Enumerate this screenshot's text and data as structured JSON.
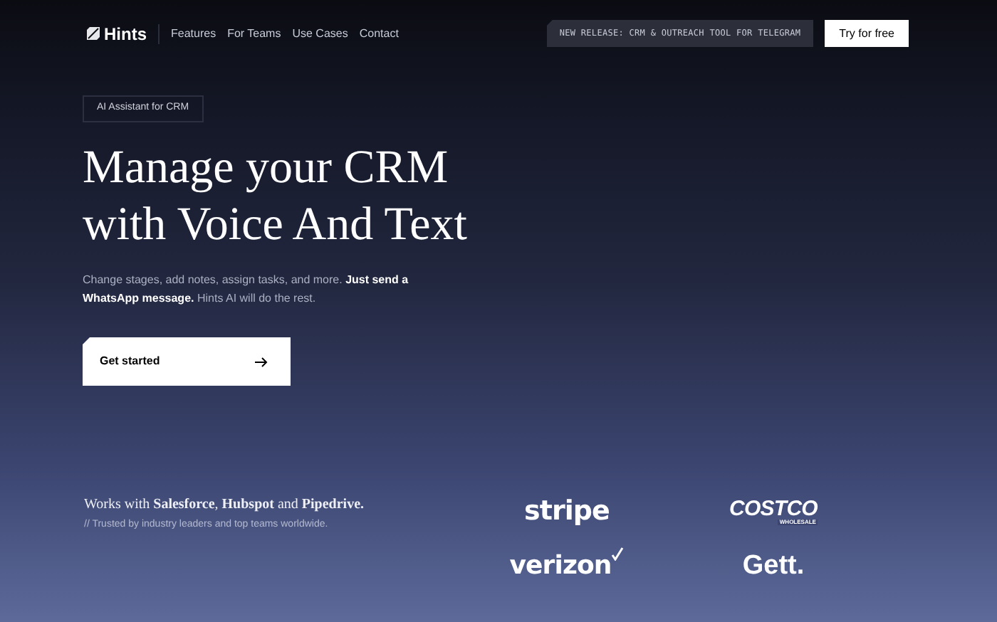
{
  "nav": {
    "brand": "Hints",
    "links": [
      "Features",
      "For Teams",
      "Use Cases",
      "Contact"
    ],
    "announcement": "NEW RELEASE: CRM & OUTREACH TOOL FOR TELEGRAM",
    "cta": "Try for free"
  },
  "hero": {
    "badge": "AI Assistant for CRM",
    "headline_lines": [
      "Manage your CRM",
      "with Voice And Text"
    ],
    "subtitle": "Change stages, add notes, assign tasks, and more. **Just send a WhatsApp message.** Hints AI will do the rest.",
    "button": "Get started"
  },
  "partners": {
    "heading": "Works with **Salesforce**, **Hubspot** and **Pipedrive.**",
    "note": "// Trusted by industry leaders and top teams worldwide.",
    "logos": [
      {
        "kind": "stripe",
        "text": "stripe"
      },
      {
        "kind": "costco",
        "text": "COSTCO",
        "subtext": "WHOLESALE"
      },
      {
        "kind": "verizon",
        "text": "verizon"
      },
      {
        "kind": "gett",
        "text": "Gett."
      }
    ]
  }
}
